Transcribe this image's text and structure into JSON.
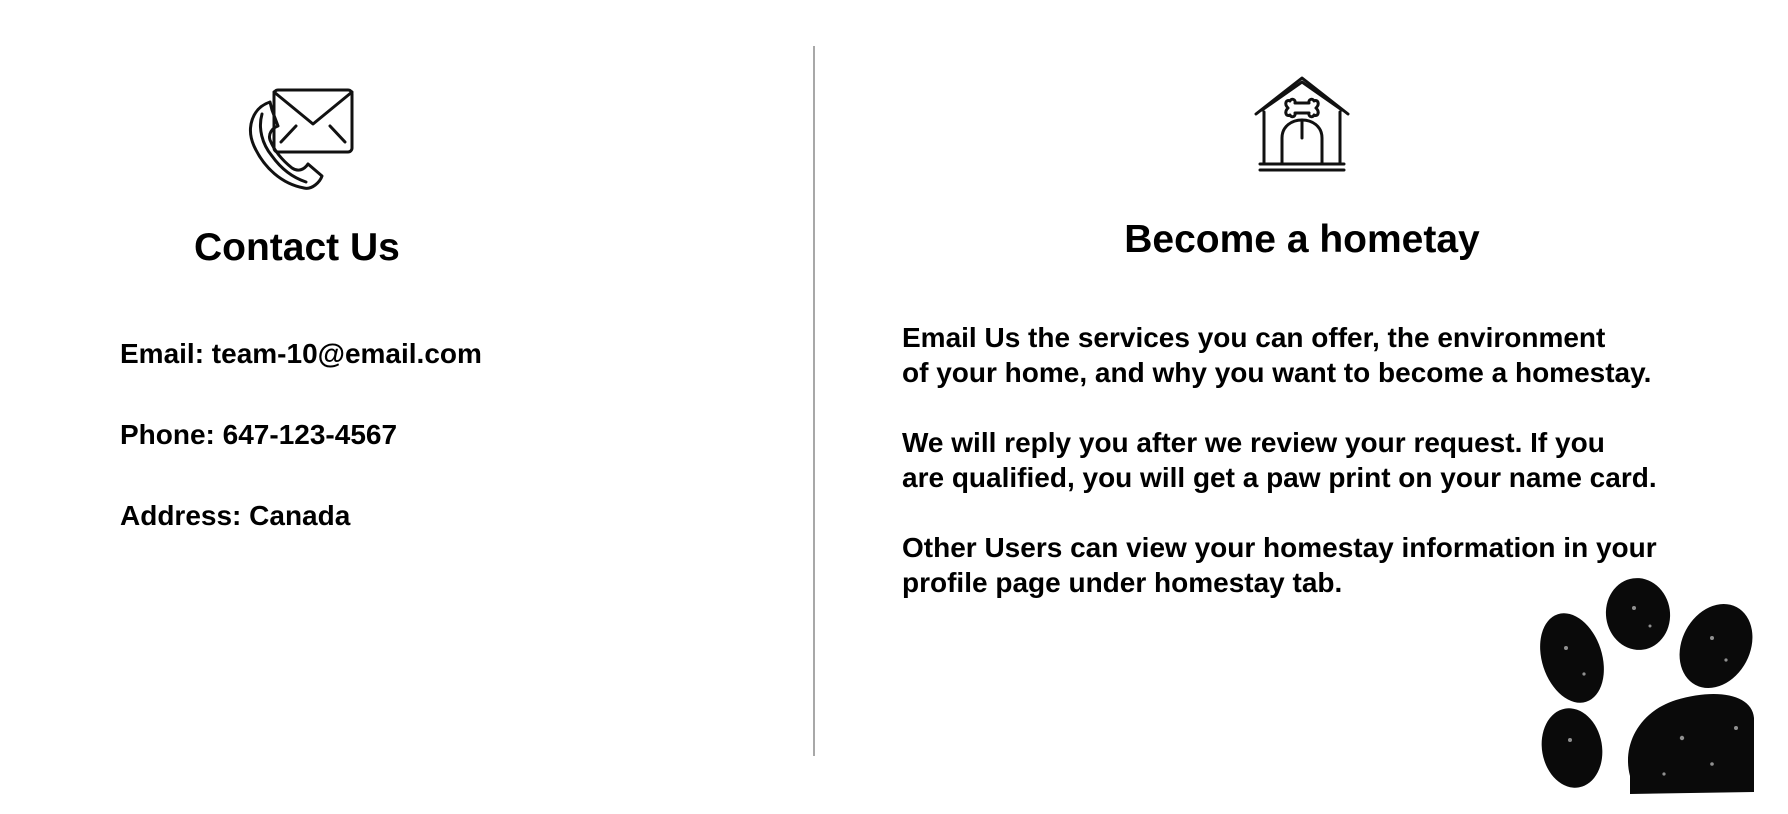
{
  "contact": {
    "title": "Contact Us",
    "email": "Email: team-10@email.com",
    "phone": "Phone: 647-123-4567",
    "address": "Address: Canada",
    "icon": "phone-envelope-icon"
  },
  "homestay": {
    "title": "Become a hometay",
    "icon": "dog-house-icon",
    "paragraphs": [
      {
        "line1": "Email Us the services you can offer, the environment",
        "line2": "of  your home, and why you want to become a homestay."
      },
      {
        "line1": "We will reply you after we review your request. If  you",
        "line2": "are qualified, you will get a paw print on your name card."
      },
      {
        "line1": "Other Users can view your homestay information in your",
        "line2": "profile page under homestay tab."
      }
    ],
    "decoration": "paw-print-icon"
  }
}
